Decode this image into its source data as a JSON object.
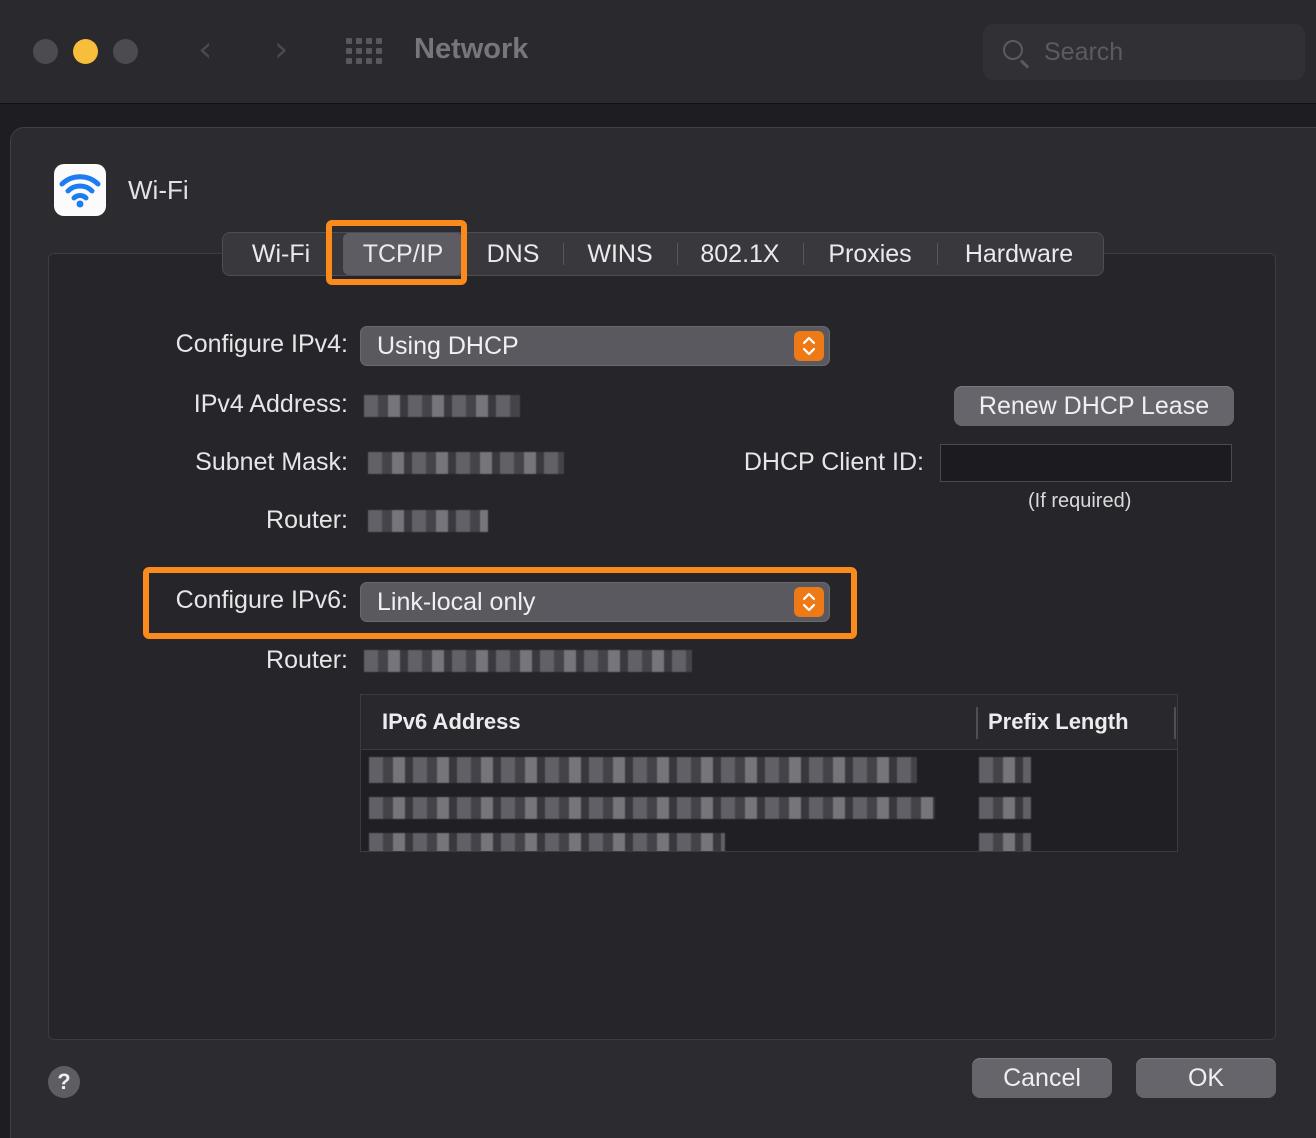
{
  "window": {
    "title": "Network",
    "search_placeholder": "Search",
    "back_icon": "chevron-left-icon",
    "forward_icon": "chevron-right-icon"
  },
  "interface": {
    "name": "Wi-Fi",
    "icon": "wifi-icon"
  },
  "tabs": [
    {
      "label": "Wi-Fi",
      "active": false
    },
    {
      "label": "TCP/IP",
      "active": true
    },
    {
      "label": "DNS",
      "active": false
    },
    {
      "label": "WINS",
      "active": false
    },
    {
      "label": "802.1X",
      "active": false
    },
    {
      "label": "Proxies",
      "active": false
    },
    {
      "label": "Hardware",
      "active": false
    }
  ],
  "ipv4": {
    "configure_label": "Configure IPv4:",
    "configure_value": "Using DHCP",
    "address_label": "IPv4 Address:",
    "subnet_label": "Subnet Mask:",
    "router_label": "Router:",
    "renew_button": "Renew DHCP Lease",
    "client_id_label": "DHCP Client ID:",
    "client_id_value": "",
    "client_id_hint": "(If required)"
  },
  "ipv6": {
    "configure_label": "Configure IPv6:",
    "configure_value": "Link-local only",
    "router_label": "Router:",
    "table": {
      "columns": [
        "IPv6 Address",
        "Prefix Length"
      ]
    }
  },
  "footer": {
    "help_label": "?",
    "cancel_label": "Cancel",
    "ok_label": "OK"
  },
  "colors": {
    "highlight": "#fa8a1b",
    "stepper": "#ee7a17",
    "wifi_blue": "#1d7cf2"
  }
}
